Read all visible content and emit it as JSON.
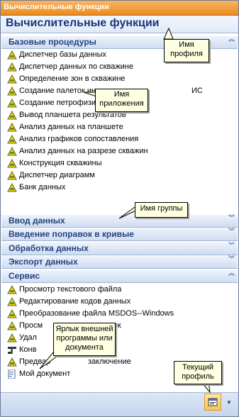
{
  "window": {
    "title": "Вычислительные функции"
  },
  "profile": {
    "title": "Вычислительные функции"
  },
  "groups": [
    {
      "label": "Базовые процедуры",
      "expanded": true,
      "items": [
        {
          "label": "Диспетчер базы данных",
          "icon": "triangle-warning-icon"
        },
        {
          "label": "Диспетчер данных по скважине",
          "icon": "triangle-warning-icon"
        },
        {
          "label": "Определение зон в скважине",
          "icon": "triangle-warning-icon"
        },
        {
          "label": "Создание палеток ин",
          "icon": "triangle-warning-icon"
        },
        {
          "label": "Создание петрофизи",
          "icon": "triangle-warning-icon"
        },
        {
          "label": "Вывод планшета результатов",
          "icon": "triangle-warning-icon"
        },
        {
          "label": "Анализ данных на планшете",
          "icon": "triangle-warning-icon"
        },
        {
          "label": "Анализ графиков сопоставления",
          "icon": "triangle-warning-icon"
        },
        {
          "label": "Анализ данных на разрезе скважин",
          "icon": "triangle-warning-icon"
        },
        {
          "label": "Конструкция скважины",
          "icon": "triangle-warning-icon"
        },
        {
          "label": "Диспетчер диаграмм",
          "icon": "triangle-warning-icon"
        },
        {
          "label": "Банк данных",
          "icon": "triangle-warning-icon"
        }
      ],
      "hidden_fragment": "ИС"
    },
    {
      "label": "Ввод данных",
      "expanded": false
    },
    {
      "label": "Введение поправок в кривые",
      "expanded": false
    },
    {
      "label": "Обработка данных",
      "expanded": false
    },
    {
      "label": "Экспорт данных",
      "expanded": false
    },
    {
      "label": "Сервис",
      "expanded": true,
      "items": [
        {
          "label": "Просмотр текстового файла",
          "icon": "triangle-warning-icon"
        },
        {
          "label": "Редактирование кодов данных",
          "icon": "triangle-warning-icon"
        },
        {
          "label": "Преобразование файла MSDOS--Windows",
          "icon": "triangle-warning-icon"
        },
        {
          "label": "Просм",
          "icon": "triangle-warning-icon",
          "tail": "вок"
        },
        {
          "label": "Удал",
          "icon": "triangle-warning-icon"
        },
        {
          "label": "Конв",
          "icon": "tools-icon"
        },
        {
          "label": "Предвар",
          "icon": "triangle-warning-icon",
          "tail": "заключение"
        },
        {
          "label": "Мой документ",
          "icon": "document-icon"
        }
      ]
    }
  ],
  "callouts": {
    "profile_name": [
      "Имя",
      "профиля"
    ],
    "app_name": [
      "Имя",
      "приложения"
    ],
    "group_name": [
      "Имя группы"
    ],
    "external_shortcut": [
      "Ярлык внешней",
      "программы или",
      "документа"
    ],
    "current_profile": [
      "Текущий",
      "профиль"
    ]
  },
  "colors": {
    "title": "#e98b1e",
    "group_text": "#24437f",
    "profile_text": "#17357c"
  }
}
